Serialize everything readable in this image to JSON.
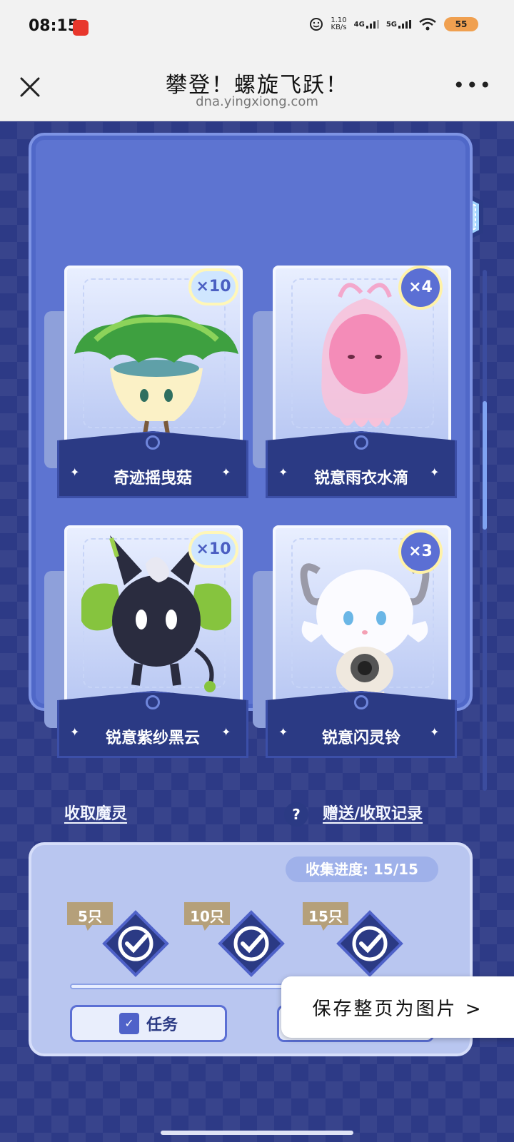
{
  "status_bar": {
    "time": "08:15",
    "speed_top": "1.10",
    "speed_bottom": "KB/s",
    "sig1": "4G",
    "sig2": "5G",
    "battery": "55"
  },
  "title_bar": {
    "title": "攀登！螺旋飞跃！",
    "url": "dna.yingxiong.com",
    "more": "•••"
  },
  "cards": [
    {
      "name": "奇迹摇曳菇",
      "count": "×10"
    },
    {
      "name": "锐意雨衣水滴",
      "count": "×4"
    },
    {
      "name": "锐意紫纱黑云",
      "count": "×10"
    },
    {
      "name": "锐意闪灵铃",
      "count": "×3"
    }
  ],
  "links": {
    "collect": "收取魔灵",
    "help_mark": "?",
    "records": "赠送/收取记录"
  },
  "progress": {
    "label": "收集进度: 15/15",
    "milestones": [
      "5只",
      "10只",
      "15只"
    ]
  },
  "task_button": "任务",
  "save_popup": "保存整页为图片 >",
  "icons": [
    "home-icon",
    "help-icon",
    "music-icon",
    "share-icon",
    "close-icon",
    "more-icon"
  ]
}
